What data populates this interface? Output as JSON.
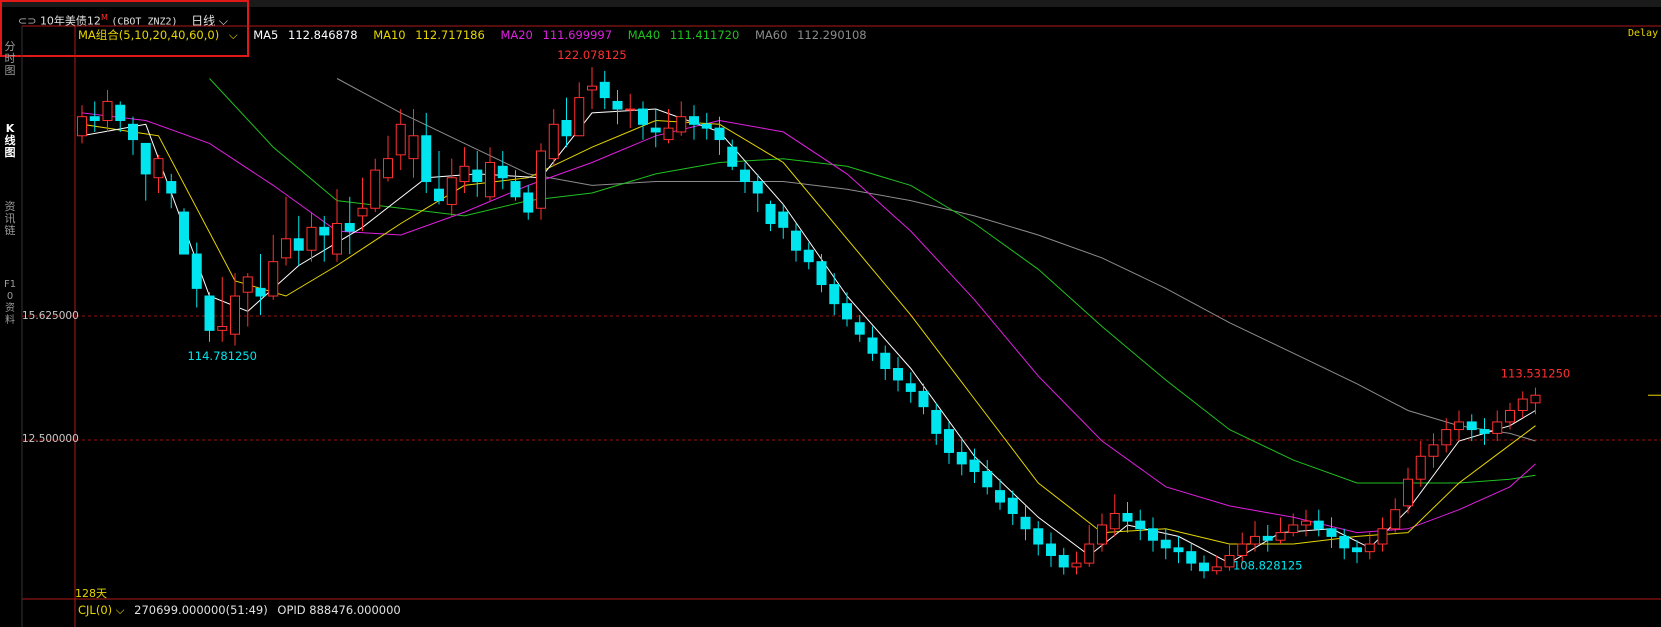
{
  "header": {
    "link_icon": "link-icon",
    "instrument_name": "10年美债12",
    "instrument_flag": "M",
    "instrument_code": "(CBOT ZNZ2)",
    "period_label": "日线",
    "period_icon": "chevron-down-icon",
    "delay_label": "Delay"
  },
  "sidebar": {
    "tabs": [
      {
        "label": "分时图",
        "active": false
      },
      {
        "label": "K线图",
        "active": true
      },
      {
        "label": "资讯链",
        "active": false
      },
      {
        "label": "F10资料",
        "active": false
      }
    ]
  },
  "ma_legend": {
    "group_label": "MA组合(5,10,20,40,60,0)",
    "items": [
      {
        "name": "MA5",
        "value": "112.846878",
        "color": "#ffffff"
      },
      {
        "name": "MA10",
        "value": "112.717186",
        "color": "#e6d600"
      },
      {
        "name": "MA20",
        "value": "111.699997",
        "color": "#e020e0"
      },
      {
        "name": "MA40",
        "value": "111.411720",
        "color": "#20c020"
      },
      {
        "name": "MA60",
        "value": "112.290108",
        "color": "#8c8c8c"
      }
    ]
  },
  "volume": {
    "label": "CJL(0)",
    "value_text": "270699.000000(51:49)",
    "opid_text": "OPID 888476.000000"
  },
  "colors": {
    "up": "#ff3030",
    "down": "#00e5ee",
    "grid": "#9b1010",
    "frame": "#b01818",
    "ma5": "#ffffff",
    "ma10": "#e6d600",
    "ma20": "#e020e0",
    "ma40": "#20c020",
    "ma60": "#8c8c8c"
  },
  "chart_data": {
    "type": "candlestick",
    "period_label": "128天",
    "y_axis_labels": [
      "15.625000",
      "12.500000"
    ],
    "ylim": [
      108.5,
      122.6
    ],
    "annotations": {
      "high": {
        "label": "122.078125",
        "index": 40
      },
      "low_left": {
        "label": "114.781250",
        "index": 11
      },
      "low_right": {
        "label": "108.828125",
        "index": 93
      },
      "last": {
        "label": "113.531250",
        "index": 114
      }
    },
    "candles": [
      [
        120.3,
        120.8,
        121.1,
        120.1
      ],
      [
        120.8,
        120.7,
        121.2,
        120.4
      ],
      [
        120.7,
        121.2,
        121.5,
        120.4
      ],
      [
        121.1,
        120.7,
        121.2,
        120.4
      ],
      [
        120.6,
        120.2,
        120.8,
        119.8
      ],
      [
        120.1,
        119.3,
        120.1,
        118.6
      ],
      [
        119.2,
        119.7,
        119.8,
        118.8
      ],
      [
        119.1,
        118.8,
        119.3,
        118.4
      ],
      [
        118.3,
        117.2,
        118.4,
        117.2
      ],
      [
        117.2,
        116.3,
        117.5,
        115.8
      ],
      [
        116.1,
        115.2,
        116.2,
        114.9
      ],
      [
        115.2,
        115.3,
        116.6,
        114.9
      ],
      [
        115.1,
        116.1,
        116.7,
        114.8
      ],
      [
        116.2,
        116.6,
        116.7,
        115.3
      ],
      [
        116.3,
        116.1,
        117.2,
        115.6
      ],
      [
        116.1,
        117.0,
        117.7,
        116.0
      ],
      [
        117.1,
        117.6,
        118.7,
        116.9
      ],
      [
        117.6,
        117.3,
        118.2,
        116.9
      ],
      [
        117.3,
        117.9,
        118.3,
        117.0
      ],
      [
        117.9,
        117.7,
        118.2,
        117.0
      ],
      [
        117.2,
        118.0,
        118.9,
        117.0
      ],
      [
        118.0,
        117.8,
        118.7,
        117.2
      ],
      [
        118.2,
        118.4,
        119.2,
        117.8
      ],
      [
        118.4,
        119.4,
        119.7,
        118.3
      ],
      [
        119.2,
        119.7,
        120.3,
        119.1
      ],
      [
        119.8,
        120.6,
        121.0,
        119.4
      ],
      [
        119.7,
        120.3,
        121.0,
        119.2
      ],
      [
        120.3,
        119.1,
        120.9,
        118.8
      ],
      [
        118.9,
        118.6,
        119.9,
        118.5
      ],
      [
        118.5,
        119.2,
        119.7,
        118.2
      ],
      [
        119.1,
        119.5,
        120.0,
        118.8
      ],
      [
        119.4,
        119.1,
        119.9,
        118.7
      ],
      [
        118.7,
        119.6,
        120.0,
        118.6
      ],
      [
        119.5,
        119.2,
        119.9,
        118.9
      ],
      [
        119.1,
        118.7,
        119.4,
        118.6
      ],
      [
        118.8,
        118.3,
        119.0,
        118.1
      ],
      [
        118.4,
        119.9,
        120.1,
        118.1
      ],
      [
        119.7,
        120.6,
        121.0,
        119.5
      ],
      [
        120.7,
        120.3,
        121.3,
        120.0
      ],
      [
        120.3,
        121.3,
        121.7,
        120.3
      ],
      [
        121.5,
        121.6,
        122.1,
        121.0
      ],
      [
        121.7,
        121.3,
        122.0,
        121.0
      ],
      [
        121.2,
        121.0,
        121.5,
        120.6
      ],
      [
        121.0,
        121.0,
        121.4,
        120.5
      ],
      [
        121.0,
        120.6,
        121.2,
        120.2
      ],
      [
        120.5,
        120.4,
        121.0,
        120.0
      ],
      [
        120.2,
        120.5,
        121.0,
        120.1
      ],
      [
        120.4,
        120.8,
        121.2,
        120.3
      ],
      [
        120.8,
        120.6,
        121.1,
        120.2
      ],
      [
        120.6,
        120.5,
        120.9,
        120.2
      ],
      [
        120.5,
        120.2,
        120.8,
        119.8
      ],
      [
        120.0,
        119.5,
        120.2,
        119.4
      ],
      [
        119.4,
        119.1,
        119.6,
        118.8
      ],
      [
        119.1,
        118.8,
        119.3,
        118.3
      ],
      [
        118.5,
        118.0,
        118.6,
        117.8
      ],
      [
        118.3,
        117.9,
        118.5,
        117.6
      ],
      [
        117.8,
        117.3,
        118.0,
        117.0
      ],
      [
        117.3,
        117.0,
        117.5,
        116.8
      ],
      [
        117.0,
        116.4,
        117.2,
        116.2
      ],
      [
        116.4,
        115.9,
        116.7,
        115.6
      ],
      [
        115.9,
        115.5,
        116.2,
        115.3
      ],
      [
        115.4,
        115.1,
        115.6,
        114.9
      ],
      [
        115.0,
        114.6,
        115.3,
        114.4
      ],
      [
        114.6,
        114.2,
        114.8,
        113.9
      ],
      [
        114.2,
        113.9,
        114.5,
        113.6
      ],
      [
        113.8,
        113.6,
        114.1,
        113.3
      ],
      [
        113.6,
        113.2,
        113.8,
        113.0
      ],
      [
        113.1,
        112.5,
        113.3,
        112.2
      ],
      [
        112.6,
        112.0,
        112.8,
        111.7
      ],
      [
        112.0,
        111.7,
        112.4,
        111.4
      ],
      [
        111.8,
        111.5,
        112.1,
        111.2
      ],
      [
        111.5,
        111.1,
        111.8,
        110.9
      ],
      [
        111.0,
        110.7,
        111.3,
        110.5
      ],
      [
        110.8,
        110.4,
        111.0,
        110.1
      ],
      [
        110.3,
        110.0,
        110.6,
        109.7
      ],
      [
        110.0,
        109.6,
        110.2,
        109.3
      ],
      [
        109.6,
        109.3,
        109.9,
        109.0
      ],
      [
        109.3,
        109.0,
        109.5,
        108.8
      ],
      [
        109.0,
        109.1,
        109.4,
        108.8
      ],
      [
        109.1,
        109.6,
        110.1,
        109.0
      ],
      [
        109.6,
        110.1,
        110.4,
        109.4
      ],
      [
        110.0,
        110.4,
        110.9,
        109.8
      ],
      [
        110.4,
        110.2,
        110.7,
        109.9
      ],
      [
        110.2,
        110.0,
        110.5,
        109.7
      ],
      [
        110.0,
        109.7,
        110.3,
        109.4
      ],
      [
        109.7,
        109.5,
        110.0,
        109.2
      ],
      [
        109.5,
        109.4,
        109.8,
        109.1
      ],
      [
        109.4,
        109.1,
        109.6,
        108.9
      ],
      [
        109.1,
        108.9,
        109.3,
        108.7
      ],
      [
        108.9,
        109.0,
        109.3,
        108.8
      ],
      [
        109.0,
        109.3,
        109.6,
        108.9
      ],
      [
        109.3,
        109.6,
        109.9,
        109.1
      ],
      [
        109.6,
        109.8,
        110.2,
        109.4
      ],
      [
        109.8,
        109.7,
        110.1,
        109.4
      ],
      [
        109.7,
        109.9,
        110.3,
        109.6
      ],
      [
        109.9,
        110.1,
        110.4,
        109.8
      ],
      [
        110.1,
        110.2,
        110.5,
        109.8
      ],
      [
        110.2,
        110.0,
        110.5,
        109.8
      ],
      [
        110.0,
        109.8,
        110.3,
        109.5
      ],
      [
        109.8,
        109.5,
        110.0,
        109.2
      ],
      [
        109.5,
        109.4,
        109.7,
        109.1
      ],
      [
        109.4,
        109.6,
        109.9,
        109.2
      ],
      [
        109.6,
        110.0,
        110.3,
        109.4
      ],
      [
        110.0,
        110.5,
        110.8,
        109.9
      ],
      [
        110.6,
        111.3,
        111.6,
        110.4
      ],
      [
        111.3,
        111.9,
        112.3,
        111.1
      ],
      [
        111.9,
        112.2,
        112.5,
        111.6
      ],
      [
        112.2,
        112.6,
        112.9,
        112.0
      ],
      [
        112.6,
        112.8,
        113.1,
        112.3
      ],
      [
        112.8,
        112.6,
        113.0,
        112.3
      ],
      [
        112.6,
        112.5,
        112.9,
        112.2
      ],
      [
        112.5,
        112.8,
        113.1,
        112.3
      ],
      [
        112.8,
        113.1,
        113.3,
        112.6
      ],
      [
        113.1,
        113.4,
        113.6,
        112.9
      ],
      [
        113.3,
        113.5,
        113.7,
        113.0
      ]
    ],
    "ma": {
      "ma5": [
        [
          0,
          120.3
        ],
        [
          5,
          120.6
        ],
        [
          10,
          116.1
        ],
        [
          13,
          115.7
        ],
        [
          17,
          116.9
        ],
        [
          22,
          117.9
        ],
        [
          27,
          119.2
        ],
        [
          31,
          119.3
        ],
        [
          36,
          119.2
        ],
        [
          40,
          120.9
        ],
        [
          45,
          121.0
        ],
        [
          50,
          120.4
        ],
        [
          55,
          118.5
        ],
        [
          60,
          116.1
        ],
        [
          65,
          114.2
        ],
        [
          70,
          111.9
        ],
        [
          75,
          110.3
        ],
        [
          79,
          109.3
        ],
        [
          82,
          110.1
        ],
        [
          86,
          109.8
        ],
        [
          90,
          109.1
        ],
        [
          94,
          109.9
        ],
        [
          98,
          110.0
        ],
        [
          101,
          109.5
        ],
        [
          104,
          110.5
        ],
        [
          108,
          112.3
        ],
        [
          112,
          112.7
        ],
        [
          114,
          113.1
        ]
      ],
      "ma10": [
        [
          0,
          120.6
        ],
        [
          6,
          120.3
        ],
        [
          12,
          116.5
        ],
        [
          16,
          116.1
        ],
        [
          20,
          116.9
        ],
        [
          25,
          118.0
        ],
        [
          30,
          119.0
        ],
        [
          35,
          119.2
        ],
        [
          40,
          120.0
        ],
        [
          45,
          120.7
        ],
        [
          50,
          120.6
        ],
        [
          55,
          119.6
        ],
        [
          60,
          117.6
        ],
        [
          65,
          115.6
        ],
        [
          70,
          113.4
        ],
        [
          75,
          111.2
        ],
        [
          80,
          109.9
        ],
        [
          85,
          110.0
        ],
        [
          90,
          109.6
        ],
        [
          95,
          109.6
        ],
        [
          100,
          109.8
        ],
        [
          104,
          109.9
        ],
        [
          108,
          111.2
        ],
        [
          112,
          112.2
        ],
        [
          114,
          112.7
        ]
      ],
      "ma20": [
        [
          0,
          120.9
        ],
        [
          5,
          120.7
        ],
        [
          10,
          120.1
        ],
        [
          15,
          119.0
        ],
        [
          20,
          117.8
        ],
        [
          25,
          117.7
        ],
        [
          30,
          118.3
        ],
        [
          35,
          119.0
        ],
        [
          40,
          119.6
        ],
        [
          45,
          120.3
        ],
        [
          50,
          120.7
        ],
        [
          55,
          120.4
        ],
        [
          60,
          119.3
        ],
        [
          65,
          117.8
        ],
        [
          70,
          116.0
        ],
        [
          75,
          114.0
        ],
        [
          80,
          112.3
        ],
        [
          85,
          111.1
        ],
        [
          90,
          110.6
        ],
        [
          95,
          110.3
        ],
        [
          100,
          109.9
        ],
        [
          104,
          110.0
        ],
        [
          108,
          110.5
        ],
        [
          112,
          111.1
        ],
        [
          114,
          111.7
        ]
      ],
      "ma40": [
        [
          10,
          121.8
        ],
        [
          15,
          120.0
        ],
        [
          20,
          118.6
        ],
        [
          25,
          118.4
        ],
        [
          30,
          118.2
        ],
        [
          35,
          118.6
        ],
        [
          40,
          118.8
        ],
        [
          45,
          119.3
        ],
        [
          50,
          119.6
        ],
        [
          55,
          119.7
        ],
        [
          60,
          119.5
        ],
        [
          65,
          119.0
        ],
        [
          70,
          118.0
        ],
        [
          75,
          116.8
        ],
        [
          80,
          115.3
        ],
        [
          85,
          113.9
        ],
        [
          90,
          112.6
        ],
        [
          95,
          111.8
        ],
        [
          100,
          111.2
        ],
        [
          104,
          111.2
        ],
        [
          108,
          111.2
        ],
        [
          112,
          111.3
        ],
        [
          114,
          111.4
        ]
      ],
      "ma60": [
        [
          20,
          121.8
        ],
        [
          25,
          120.9
        ],
        [
          30,
          120.1
        ],
        [
          35,
          119.3
        ],
        [
          40,
          119.0
        ],
        [
          45,
          119.1
        ],
        [
          50,
          119.1
        ],
        [
          55,
          119.1
        ],
        [
          60,
          118.9
        ],
        [
          65,
          118.6
        ],
        [
          70,
          118.2
        ],
        [
          75,
          117.7
        ],
        [
          80,
          117.1
        ],
        [
          85,
          116.3
        ],
        [
          90,
          115.4
        ],
        [
          95,
          114.6
        ],
        [
          100,
          113.8
        ],
        [
          104,
          113.1
        ],
        [
          108,
          112.7
        ],
        [
          112,
          112.5
        ],
        [
          114,
          112.3
        ]
      ]
    }
  }
}
